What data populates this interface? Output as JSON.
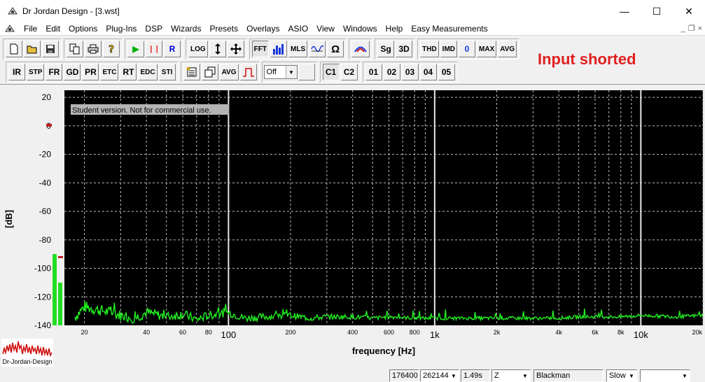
{
  "window": {
    "title": "Dr Jordan Design - [3.wst]",
    "minimize": "—",
    "maximize": "☐",
    "close": "✕"
  },
  "menu": [
    "File",
    "Edit",
    "Options",
    "Plug-Ins",
    "DSP",
    "Wizards",
    "Presets",
    "Overlays",
    "ASIO",
    "View",
    "Windows",
    "Help",
    "Easy Measurements"
  ],
  "mdi": {
    "minimize": "_",
    "restore": "❐",
    "close": "×"
  },
  "toolbar1": {
    "file_group": [
      "new-icon",
      "open-icon",
      "save-icon"
    ],
    "edit_group": [
      "copy-icon",
      "print-icon",
      "help-icon"
    ],
    "transport": {
      "play": "▶",
      "pause": "❘❘",
      "record": "R"
    },
    "log_label": "LOG",
    "fft_label": "FFT",
    "mls_label": "MLS",
    "omega_label": "Ω",
    "sg_label": "Sg",
    "three_d_label": "3D",
    "thd_label": "THD",
    "imd_label": "IMD",
    "zero_label": "0",
    "max_label": "MAX",
    "avg_label": "AVG"
  },
  "toolbar2": {
    "modes": [
      "IR",
      "STP",
      "FR",
      "GD",
      "PR",
      "ETC",
      "RT",
      "EDC",
      "STI"
    ],
    "avg_label": "AVG",
    "off_select": "Off",
    "channels": [
      "C1",
      "C2"
    ],
    "presets": [
      "01",
      "02",
      "03",
      "04",
      "05"
    ]
  },
  "annotation": "Input shorted",
  "chart_data": {
    "type": "line",
    "title": "",
    "watermark": "Student version. Not for commercial use.",
    "xlabel": "frequency [Hz]",
    "ylabel": "[dB]",
    "x_scale": "log",
    "xlim": [
      16,
      20000
    ],
    "ylim": [
      -140,
      25
    ],
    "y_ticks": [
      "20",
      "0",
      "-20",
      "-40",
      "-60",
      "-80",
      "-100",
      "-120",
      "-140"
    ],
    "x_minor_ticks": [
      "20",
      "40",
      "60",
      "80",
      "200",
      "400",
      "600",
      "800",
      "2k",
      "4k",
      "6k",
      "8k",
      "20k"
    ],
    "x_major_ticks": [
      "100",
      "1k",
      "10k"
    ],
    "grid": true,
    "background": "#000000",
    "trace_color": "#22ee22",
    "series": [
      {
        "x": [
          18,
          20,
          25,
          30,
          35,
          40,
          50,
          60,
          70,
          80,
          100,
          120,
          150,
          200,
          250,
          300,
          400,
          500,
          600,
          800,
          1000,
          1500,
          2000,
          3000,
          4000,
          5000,
          6000,
          8000,
          10000,
          15000,
          20000
        ],
        "y": [
          -134,
          -127,
          -130,
          -133,
          -135,
          -131,
          -134,
          -132,
          -136,
          -133,
          -131,
          -135,
          -134,
          -133,
          -135,
          -134,
          -134,
          -135,
          -134,
          -135,
          -135,
          -135,
          -135,
          -135,
          -135,
          -134,
          -134,
          -134,
          -133,
          -134,
          -133
        ]
      }
    ]
  },
  "level_meter": {
    "ch1_db": -90,
    "ch2_db": -110
  },
  "logo_text": "Dr-Jordan-Design",
  "status": {
    "sample_rate": "176400",
    "fft_size": "262144",
    "duration": "1.49s",
    "weighting": "Z",
    "window": "Blackman",
    "speed": "Slow",
    "extra": ""
  }
}
